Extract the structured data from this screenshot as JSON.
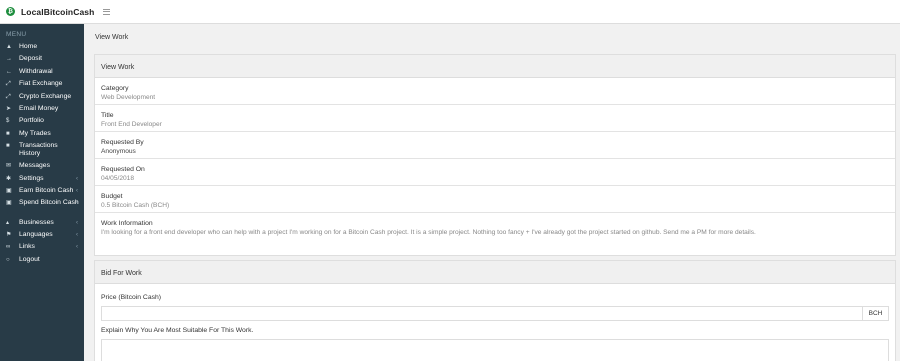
{
  "header": {
    "brand": "LocalBitcoinCash",
    "logo_icon": "bitcoin-cash-logo-icon",
    "logo_color": "#1e8e3e"
  },
  "sidebar": {
    "heading": "MENU",
    "items": [
      {
        "label": "Home",
        "icon": "▲",
        "chevron": ""
      },
      {
        "label": "Deposit",
        "icon": "→",
        "chevron": ""
      },
      {
        "label": "Withdrawal",
        "icon": "←",
        "chevron": ""
      },
      {
        "label": "Fiat Exchange",
        "icon": "⤢",
        "chevron": ""
      },
      {
        "label": "Crypto Exchange",
        "icon": "⤢",
        "chevron": ""
      },
      {
        "label": "Email Money",
        "icon": "➤",
        "chevron": ""
      },
      {
        "label": "Portfolio",
        "icon": "$",
        "chevron": ""
      },
      {
        "label": "My Trades",
        "icon": "■",
        "chevron": ""
      },
      {
        "label": "Transactions History",
        "icon": "■",
        "chevron": ""
      },
      {
        "label": "Messages",
        "icon": "✉",
        "chevron": ""
      },
      {
        "label": "Settings",
        "icon": "✱",
        "chevron": "‹"
      },
      {
        "label": "Earn Bitcoin Cash",
        "icon": "▣",
        "chevron": "‹"
      },
      {
        "label": "Spend Bitcoin Cash",
        "icon": "▣",
        "chevron": "‹"
      },
      {
        "label": "Businesses",
        "icon": "▴",
        "chevron": "‹"
      },
      {
        "label": "Languages",
        "icon": "⚑",
        "chevron": "‹"
      },
      {
        "label": "Links",
        "icon": "∞",
        "chevron": "‹"
      },
      {
        "label": "Logout",
        "icon": "○",
        "chevron": ""
      }
    ]
  },
  "main": {
    "page_title": "View Work",
    "view_panel": {
      "title": "View Work",
      "fields": [
        {
          "label": "Category",
          "value": "Web Development"
        },
        {
          "label": "Title",
          "value": "Front End Developer"
        },
        {
          "label": "Requested By",
          "value": "Anonymous"
        },
        {
          "label": "Requested On",
          "value": "04/05/2018"
        },
        {
          "label": "Budget",
          "value": "0.5 Bitcoin Cash (BCH)"
        },
        {
          "label": "Work Information",
          "value": "I'm looking for a front end developer who can help with a project I'm working on for a Bitcoin Cash project. It is a simple project. Nothing too fancy + I've already got the project started on github. Send me a PM for more details."
        }
      ]
    },
    "bid_panel": {
      "title": "Bid For Work",
      "price_label": "Price (Bitcoin Cash)",
      "price_value": "",
      "price_addon": "BCH",
      "explain_label": "Explain Why You Are Most Suitable For This Work.",
      "explain_value": ""
    }
  }
}
